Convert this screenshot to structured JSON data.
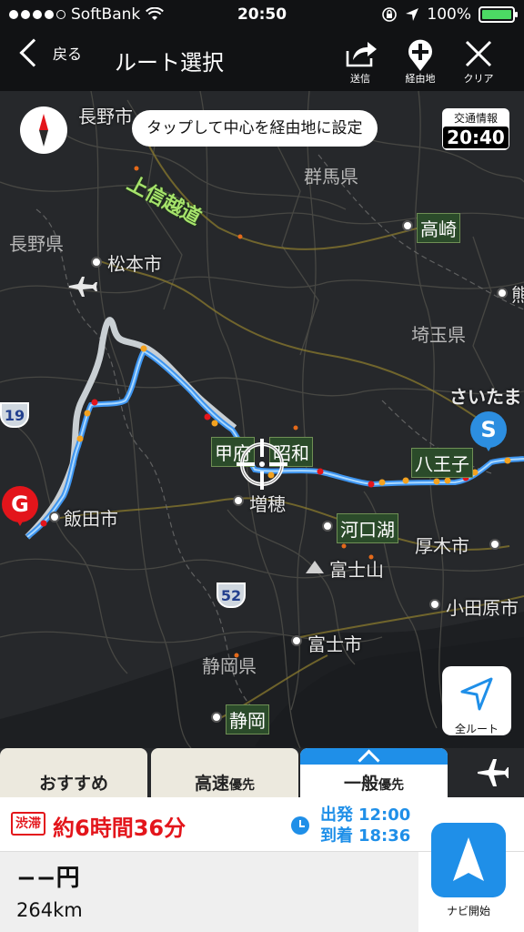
{
  "status": {
    "carrier": "SoftBank",
    "time": "20:50",
    "battery": "100%"
  },
  "nav": {
    "back_label": "戻る",
    "title": "ルート選択",
    "send_label": "送信",
    "waypoint_label": "経由地",
    "clear_label": "クリア"
  },
  "map": {
    "tooltip": "タップして中心を経由地に設定",
    "traffic_info_label": "交通情報",
    "traffic_info_time": "20:40",
    "full_route_label": "全ルート",
    "start_pin": "S",
    "goal_pin": "G",
    "road_name": "上信越道",
    "route_19": "19",
    "route_52": "52",
    "labels": {
      "nagano_city": "長野市",
      "nagano_pref": "長野県",
      "gunma_pref": "群馬県",
      "takasaki": "高崎",
      "matsumoto": "松本市",
      "saitama_pref": "埼玉県",
      "saitama_city": "さいたま",
      "kofu": "甲府",
      "showa": "昭和",
      "hachioji": "八王子",
      "iida": "飯田市",
      "masuho": "増穂",
      "kawaguchiko": "河口湖",
      "atsugi": "厚木市",
      "fujisan": "富士山",
      "odawara": "小田原市",
      "fuji_city": "富士市",
      "shizuoka_pref": "静岡県",
      "shizuoka": "静岡",
      "kuma": "熊"
    }
  },
  "tabs": {
    "recommended": "おすすめ",
    "highway_main": "高速",
    "highway_suffix": "優先",
    "general_main": "一般",
    "general_suffix": "優先"
  },
  "summary": {
    "jam_badge": "渋滞",
    "duration": "約6時間36分",
    "depart_label": "出発",
    "depart_time": "12:00",
    "arrive_label": "到着",
    "arrive_time": "18:36",
    "fare": "−−円",
    "distance": "264km",
    "navi_start_label": "ナビ開始"
  },
  "colors": {
    "accent": "#1f8fe8",
    "jam": "#e3151b",
    "start_pin": "#2c8ee0",
    "goal_pin": "#e3151b"
  }
}
